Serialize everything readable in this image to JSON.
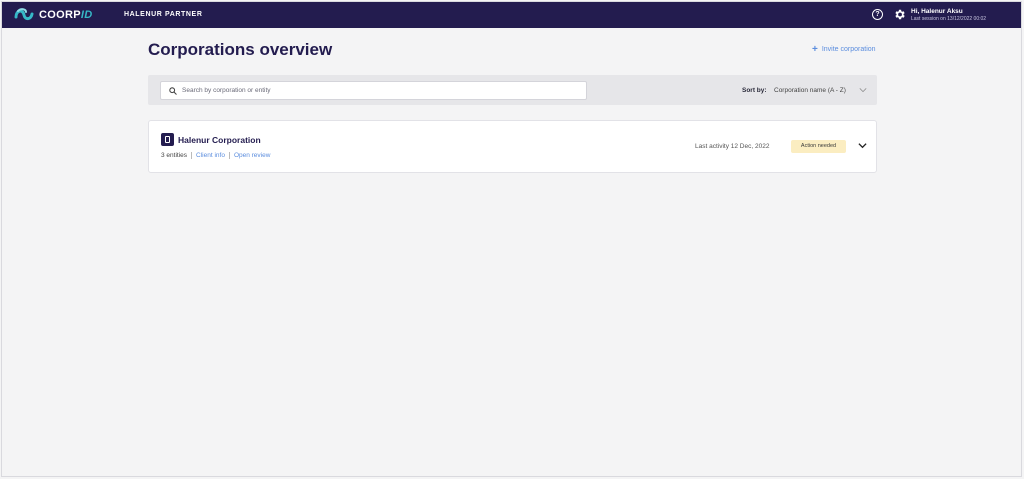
{
  "header": {
    "logo": {
      "text_main": "COORP",
      "text_accent": "ID"
    },
    "partner_label": "HALENUR PARTNER",
    "help_icon": "question-circle-icon",
    "settings_icon": "gear-icon",
    "user": {
      "greeting": "Hi, Halenur Aksu",
      "last_session": "Last session on  13/12/2022 00:02"
    },
    "colors": {
      "bar": "#231c4f",
      "accent": "#36b8c7"
    }
  },
  "main": {
    "title": "Corporations overview",
    "invite_label": "Invite corporation",
    "search": {
      "placeholder": "Search by corporation or entity",
      "value": ""
    },
    "sort": {
      "label": "Sort by:",
      "value": "Corporation name (A - Z)"
    }
  },
  "corporations": [
    {
      "name": "Halenur Corporation",
      "entities": "3 entities",
      "client_info_label": "Client info",
      "open_review_label": "Open review",
      "last_activity": "Last activity 12 Dec, 2022",
      "status": "Action needed",
      "status_color": "#fbedc1"
    }
  ]
}
